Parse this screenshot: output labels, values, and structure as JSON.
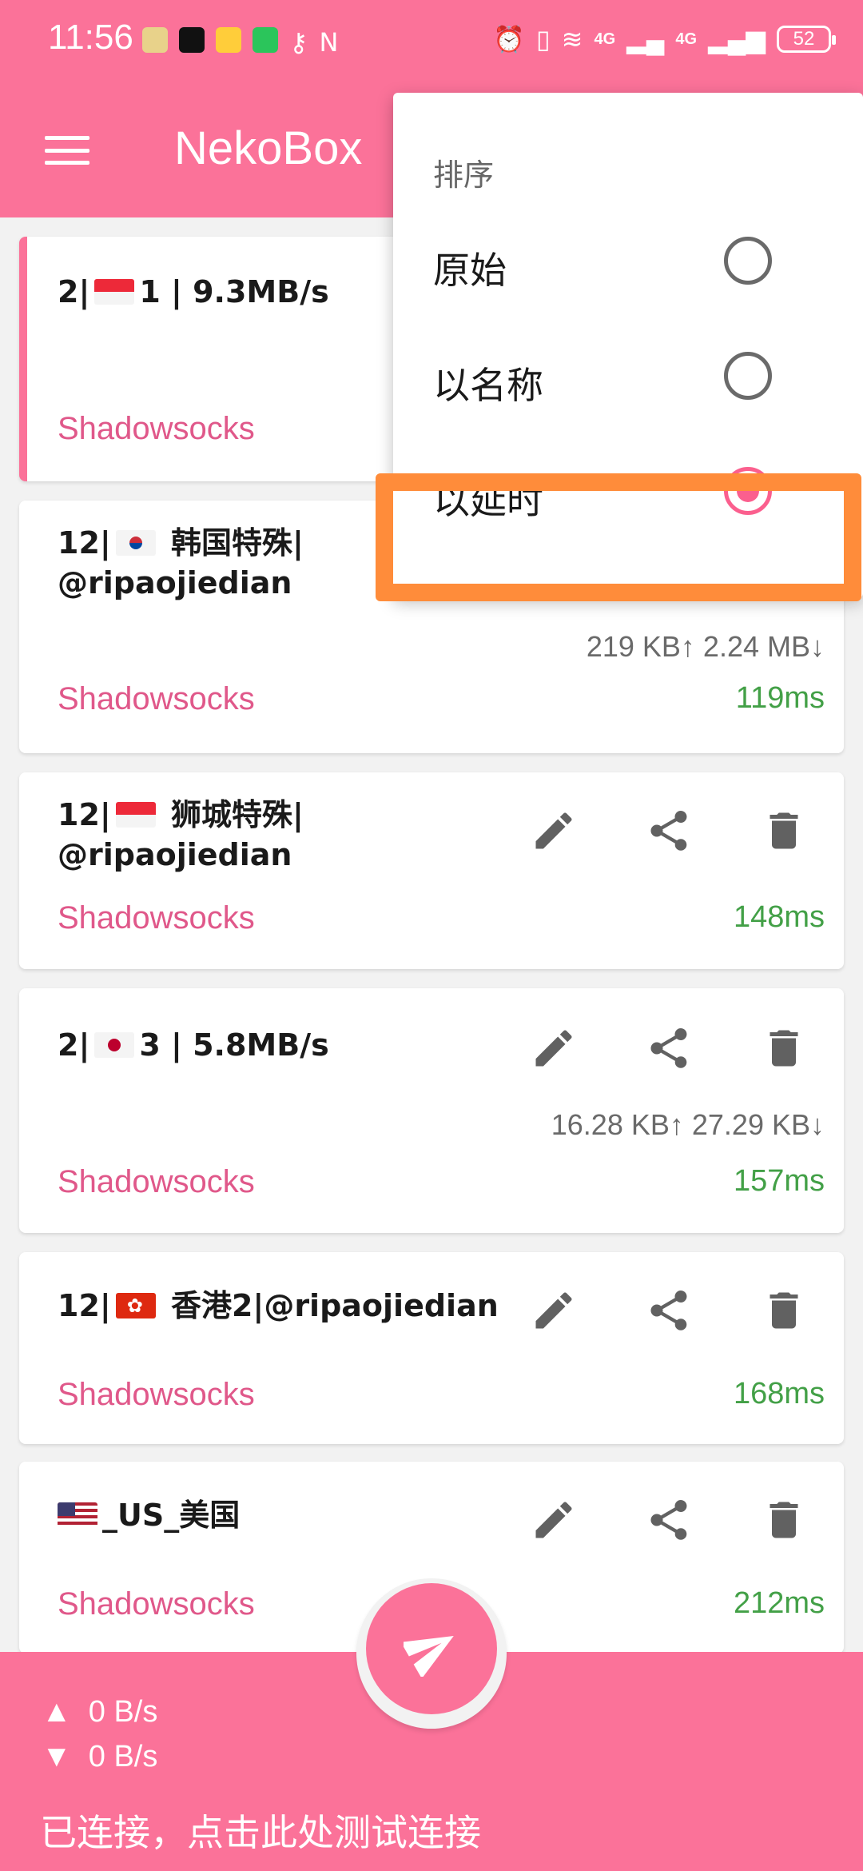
{
  "status_bar": {
    "time": "11:56",
    "signal_1": "4G",
    "signal_2": "4G",
    "battery": "52",
    "icons": [
      "app-icon",
      "terminal-icon",
      "notes-icon",
      "wechat-icon",
      "key-icon",
      "nfc-icon",
      "alarm-icon",
      "vibrate-icon",
      "wifi-icon",
      "signal-icon",
      "signal-icon",
      "battery-icon"
    ]
  },
  "appbar": {
    "title": "NekoBox",
    "menu_icon": "hamburger-icon"
  },
  "sort_menu": {
    "header": "排序",
    "options": [
      {
        "label": "原始",
        "selected": false
      },
      {
        "label": "以名称",
        "selected": false
      },
      {
        "label": "以延时",
        "selected": true
      }
    ]
  },
  "profiles": [
    {
      "title_pre": "2|",
      "flag": "SG",
      "title_post": "1 |  9.3MB/s",
      "type": "Shadowsocks",
      "traffic": "",
      "latency": "",
      "selected": true
    },
    {
      "title_pre": "12|",
      "flag": "KR",
      "title_post": " 韩国特殊|",
      "title_line2": "@ripaojiedian",
      "type": "Shadowsocks",
      "traffic": "219 KB↑ 2.24 MB↓",
      "latency": "119ms"
    },
    {
      "title_pre": "12|",
      "flag": "SG",
      "title_post": " 狮城特殊|",
      "title_line2": "@ripaojiedian",
      "type": "Shadowsocks",
      "traffic": "",
      "latency": "148ms"
    },
    {
      "title_pre": "2|",
      "flag": "JP",
      "title_post": "3 |  5.8MB/s",
      "type": "Shadowsocks",
      "traffic": "16.28 KB↑ 27.29 KB↓",
      "latency": "157ms"
    },
    {
      "title_pre": "12|",
      "flag": "HK",
      "title_post": " 香港2|@ripaojiedian",
      "type": "Shadowsocks",
      "traffic": "",
      "latency": "168ms"
    },
    {
      "title_pre": "",
      "flag": "US",
      "title_post": "_US_美国",
      "type": "Shadowsocks",
      "traffic": "",
      "latency": "212ms"
    }
  ],
  "bottom_bar": {
    "upload": "0 B/s",
    "download": "0 B/s",
    "upload_arrow": "▲",
    "download_arrow": "▼",
    "status": "已连接，点击此处测试连接"
  },
  "colors": {
    "accent": "#fb7299",
    "protocol": "#e0588a",
    "latency": "#43a047",
    "highlight": "#ff8c3a"
  }
}
